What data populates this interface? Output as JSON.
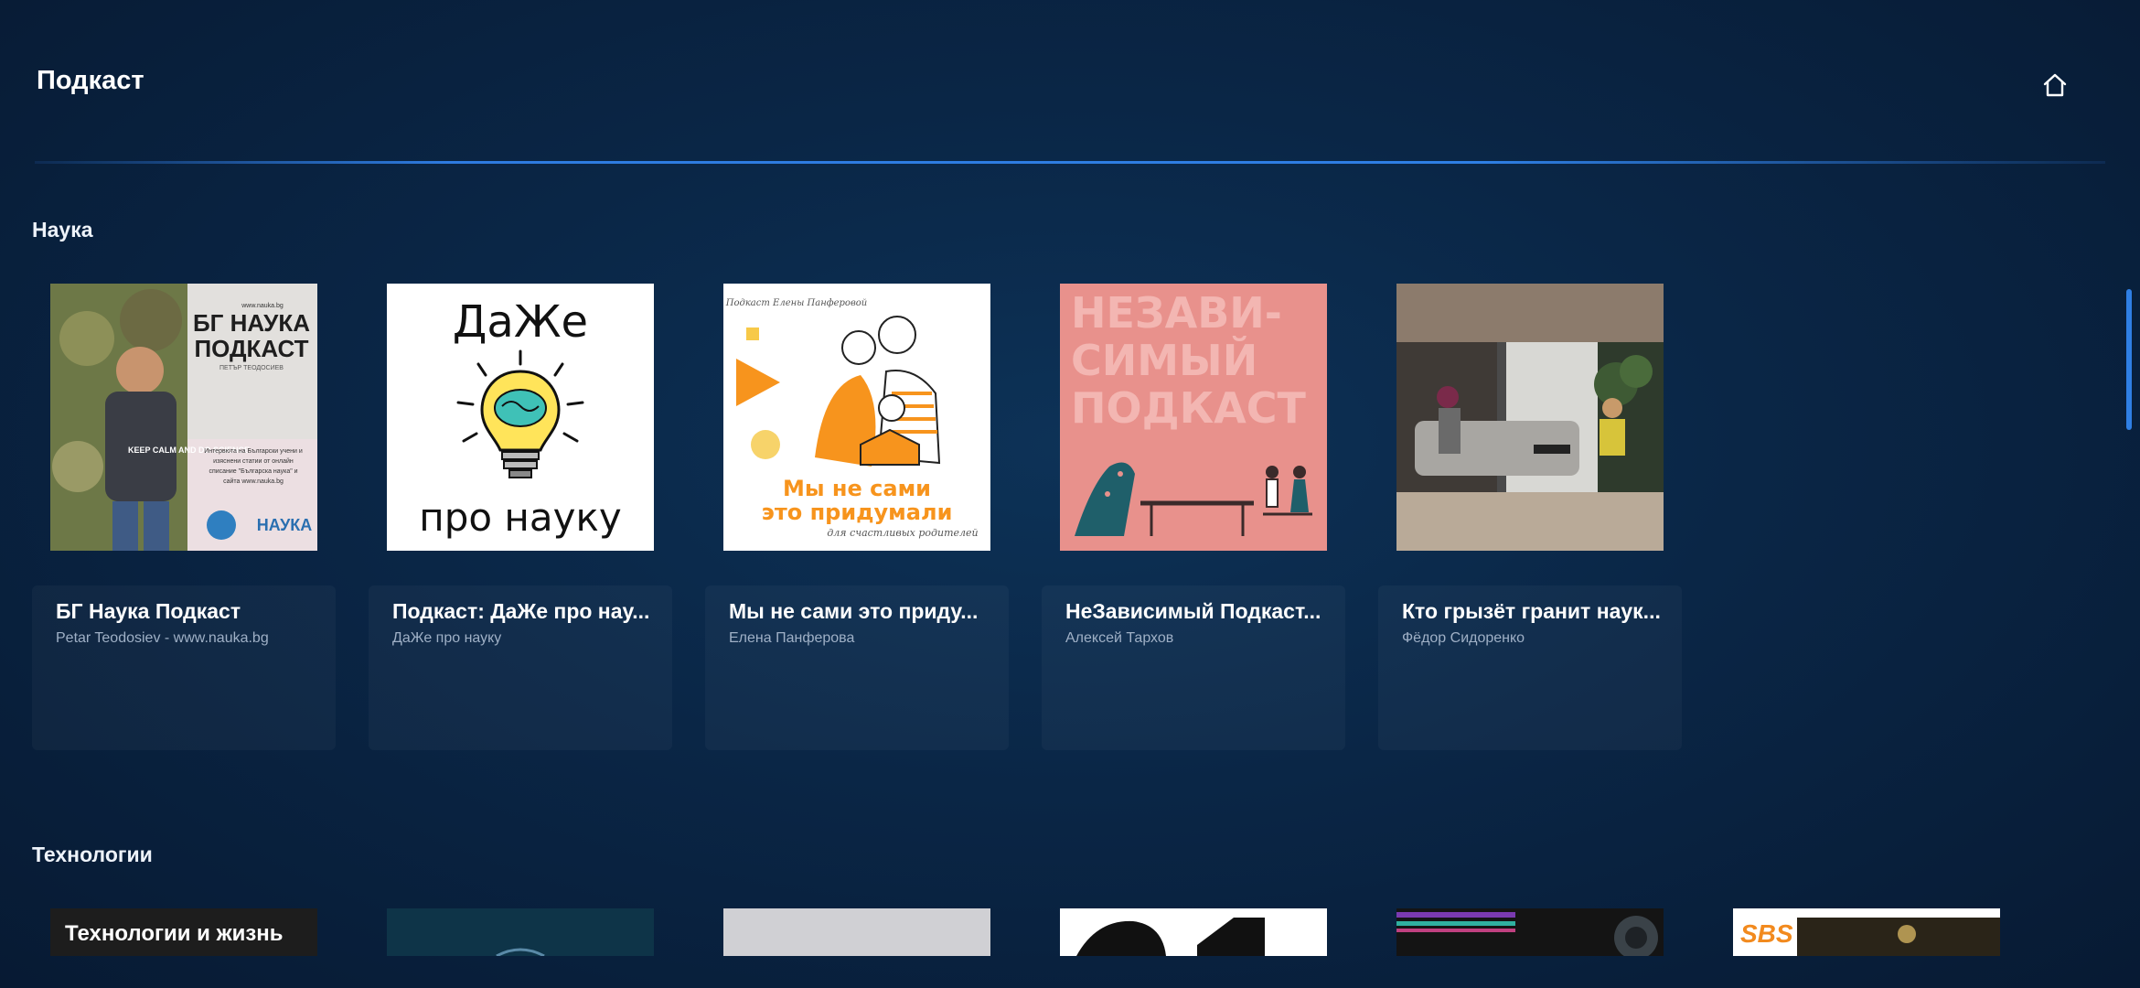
{
  "header": {
    "title": "Подкаст",
    "home_icon": "home-icon"
  },
  "sections": [
    {
      "title": "Наука",
      "items": [
        {
          "title": "БГ Наука Подкаст",
          "author": "Petar Teodosiev - www.nauka.bg",
          "cover": {
            "heading": "БГ НАУКА\nПОДКАСТ",
            "host": "ПЕТЪР ТЕОДОСИЕВ",
            "site": "www.nauka.bg",
            "shirt": "KEEP CALM AND DO SCIENCE",
            "blurb": "Интервюта на Български учени и изяснени статии от онлайн списание \"Българска наука\" и сайта www.nauka.bg",
            "logo": "НАУКА"
          }
        },
        {
          "title": "Подкаст: ДаЖе про нау...",
          "author": "ДаЖе про науку",
          "cover": {
            "top": "ДаЖе",
            "bottom": "про науку"
          }
        },
        {
          "title": "Мы не сами это приду...",
          "author": "Елена Панферова",
          "cover": {
            "top": "Подкаст Елены Панферовой",
            "main": "Мы не сами\nэто придумали",
            "sub": "для счастливых родителей"
          }
        },
        {
          "title": "НеЗависимый Подкаст...",
          "author": "Алексей Тархов",
          "cover": {
            "text": "НЕЗАВИ-\nСИМЫЙ\nПОДКАСТ"
          }
        },
        {
          "title": "Кто грызёт гранит наук...",
          "author": "Фёдор Сидоренко",
          "cover": {}
        }
      ]
    },
    {
      "title": "Технологии",
      "items": [
        {
          "cover_text": "Технологии и жизнь"
        },
        {
          "cover_text": ""
        },
        {
          "cover_text": ""
        },
        {
          "cover_text": ""
        },
        {
          "cover_text": ""
        },
        {
          "cover_text": "SBS"
        }
      ]
    }
  ],
  "colors": {
    "accent": "#2f7fe4",
    "background": "#0a2646"
  }
}
